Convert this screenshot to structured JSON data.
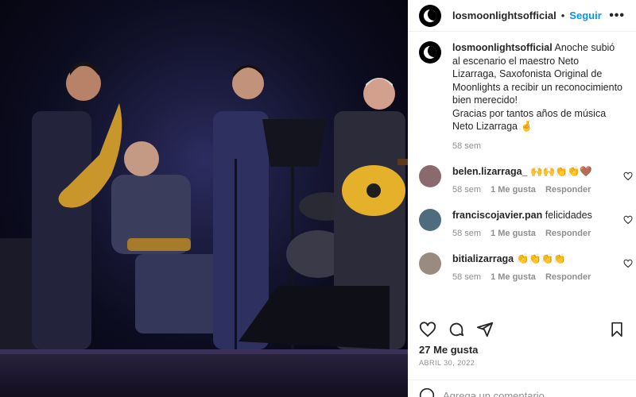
{
  "post": {
    "username": "losmoonlightsofficial",
    "follow_label": "Seguir",
    "more_label": "•••",
    "caption_lines": [
      "Anoche subió al escenario el maestro Neto Lizarraga, Saxofonista Original de Moonlights a recibir un reconocimiento bien merecido!",
      "Gracias por tantos años de música Neto Lizarraga 🤞"
    ],
    "caption_time": "58 sem",
    "likes": "27 Me gusta",
    "date": "ABRIL 30, 2022",
    "avatar_text": "MOON",
    "comment_placeholder": "Agrega un comentario..."
  },
  "comments": [
    {
      "user": "belen.lizarraga_",
      "text": "🙌🙌👏👏🤎",
      "time": "58 sem",
      "likes": "1 Me gusta",
      "reply": "Responder",
      "avatar_color": "#8a6a6e"
    },
    {
      "user": "franciscojavier.pan",
      "text": "felicidades",
      "time": "58 sem",
      "likes": "1 Me gusta",
      "reply": "Responder",
      "avatar_color": "#4f6b7e"
    },
    {
      "user": "bitializarraga",
      "text": "👏👏👏👏",
      "time": "58 sem",
      "likes": "1 Me gusta",
      "reply": "Responder",
      "avatar_color": "#9a8b80"
    }
  ],
  "colors": {
    "accent": "#0095f6",
    "muted": "#8e8e8e",
    "text": "#262626"
  },
  "icons": [
    "heart-icon",
    "comment-icon",
    "share-icon",
    "bookmark-icon",
    "emoji-icon"
  ]
}
